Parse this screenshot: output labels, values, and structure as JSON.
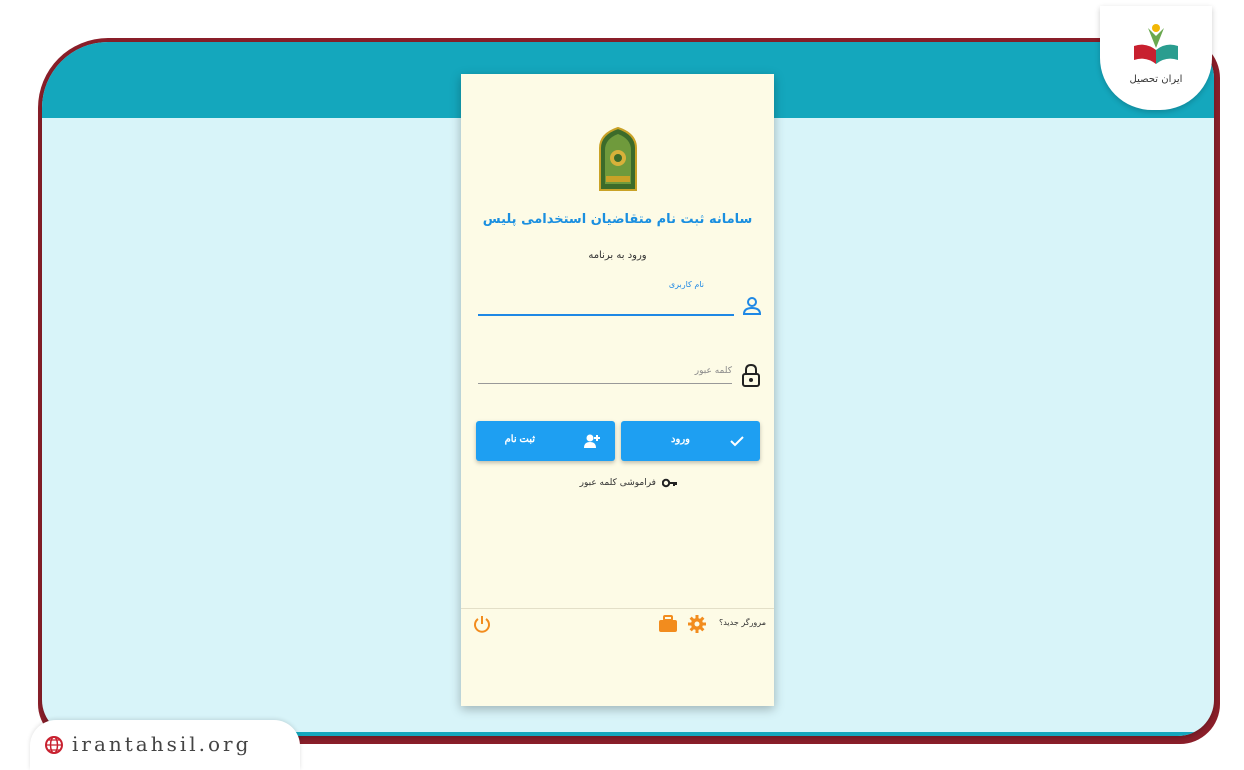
{
  "card": {
    "title": "سامانه ثبت نام متقاضیان استخدامی پلیس",
    "subtitle": "ورود به برنامه",
    "username_label": "نام کاربری",
    "password_placeholder": "کلمه عبور",
    "login_button": "ورود",
    "register_button": "ثبت نام",
    "forgot_password": "فراموشی کلمه عبور",
    "new_browser": "مرورگر جدید؟"
  },
  "brand": {
    "name": "ایران تحصیل"
  },
  "watermark": {
    "site": "irantahsil.org"
  },
  "colors": {
    "header": "#14a7bd",
    "background": "#d8f4f9",
    "card": "#fdfbe6",
    "primary": "#1e9ff2",
    "accent_orange": "#f28c1e"
  },
  "icons": [
    "user-icon",
    "lock-icon",
    "check-icon",
    "add-user-icon",
    "key-icon",
    "gear-icon",
    "briefcase-icon",
    "power-icon",
    "globe-icon"
  ]
}
